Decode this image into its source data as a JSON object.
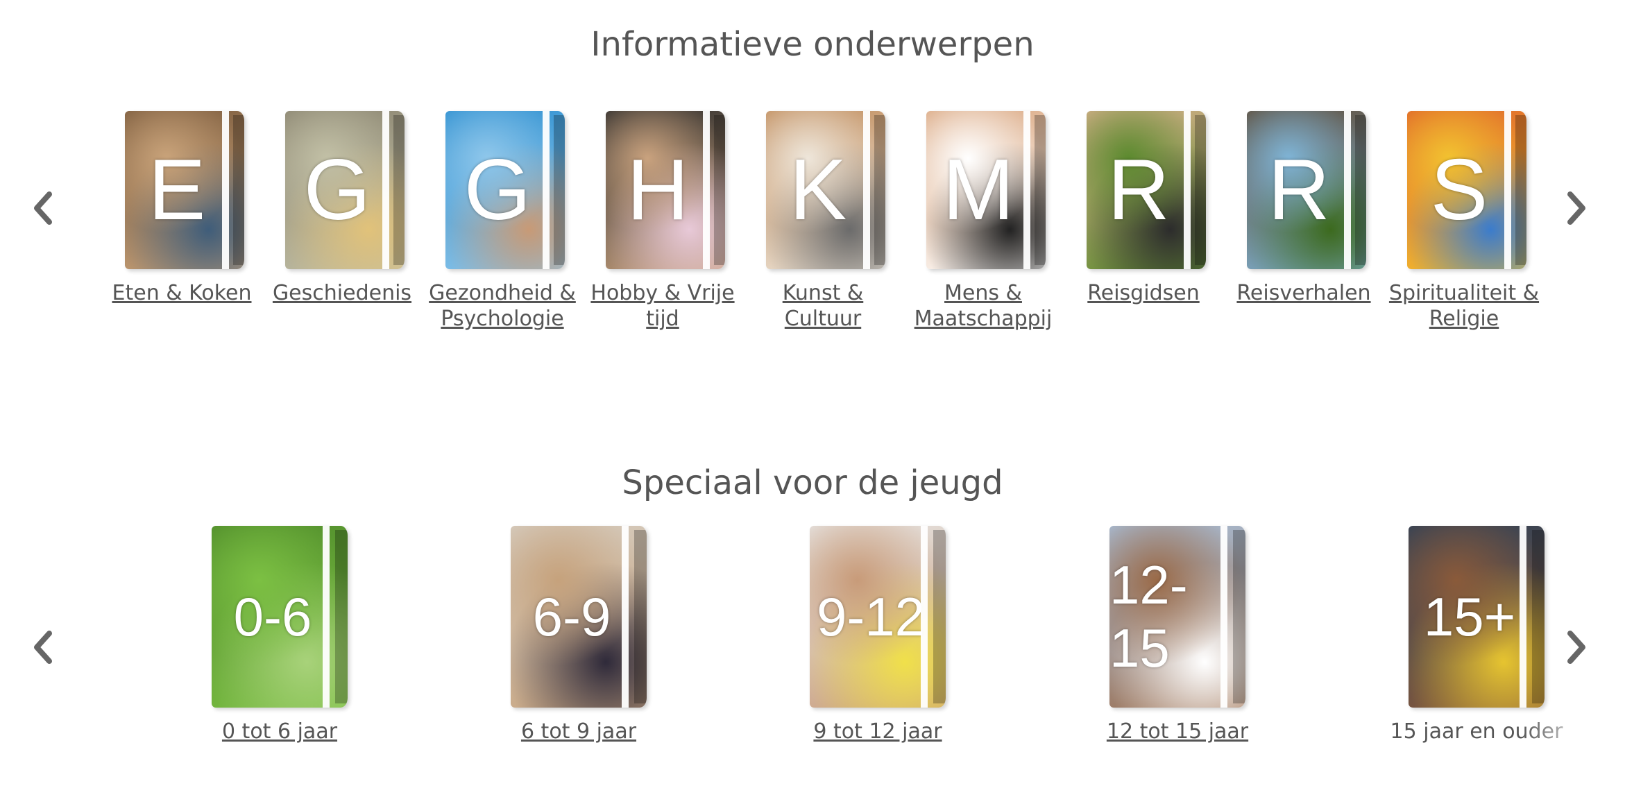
{
  "sections": [
    {
      "title": "Informatieve onderwerpen",
      "items": [
        {
          "letter": "E",
          "label": "Eten & Koken",
          "colors": [
            "#7a5a3c",
            "#c9a37a",
            "#3f5d7a"
          ]
        },
        {
          "letter": "G",
          "label": "Geschiedenis",
          "colors": [
            "#8a8470",
            "#c2c0a6",
            "#e1c27a"
          ]
        },
        {
          "letter": "G",
          "label": "Gezondheid & Psychologie",
          "colors": [
            "#2d8fd0",
            "#8fc7eb",
            "#c89a76"
          ]
        },
        {
          "letter": "H",
          "label": "Hobby & Vrije tijd",
          "colors": [
            "#2a2a2a",
            "#c9a27e",
            "#e8c9d8"
          ]
        },
        {
          "letter": "K",
          "label": "Kunst & Cultuur",
          "colors": [
            "#c08b5a",
            "#eee6da",
            "#6b6b6b"
          ]
        },
        {
          "letter": "M",
          "label": "Mens & Maatschappij",
          "colors": [
            "#d9a47c",
            "#ffffff",
            "#222222"
          ]
        },
        {
          "letter": "R",
          "label": "Reisgidsen",
          "colors": [
            "#d8b18c",
            "#5c8a2f",
            "#2c2c2c"
          ]
        },
        {
          "letter": "R",
          "label": "Reisverhalen",
          "colors": [
            "#5e4a35",
            "#7fb4d6",
            "#3c6a1e"
          ]
        },
        {
          "letter": "S",
          "label": "Spiritualiteit & Religie",
          "colors": [
            "#e0642a",
            "#f2c230",
            "#3b7ccc"
          ]
        }
      ]
    },
    {
      "title": "Speciaal voor de jeugd",
      "items": [
        {
          "letter": "0-6",
          "label": "0 tot 6 jaar",
          "colors": [
            "#4e8a2a",
            "#7cc043",
            "#a8d27a"
          ]
        },
        {
          "letter": "6-9",
          "label": "6 tot 9 jaar",
          "colors": [
            "#d7cfc4",
            "#c6a27c",
            "#2f2a3a"
          ]
        },
        {
          "letter": "9-12",
          "label": "9 tot 12 jaar",
          "colors": [
            "#e8e8e8",
            "#c89b79",
            "#f0e04a"
          ]
        },
        {
          "letter": "12-15",
          "label": "12 tot 15 jaar",
          "colors": [
            "#a9c4e2",
            "#9a6a48",
            "#ffffff"
          ]
        },
        {
          "letter": "15+",
          "label": "15 jaar en ouder",
          "colors": [
            "#2b3f57",
            "#8a5a3a",
            "#e6c430"
          ]
        }
      ]
    }
  ],
  "icons": {
    "prev": "chevron-left-icon",
    "next": "chevron-right-icon",
    "arrow_color": "#666666"
  }
}
